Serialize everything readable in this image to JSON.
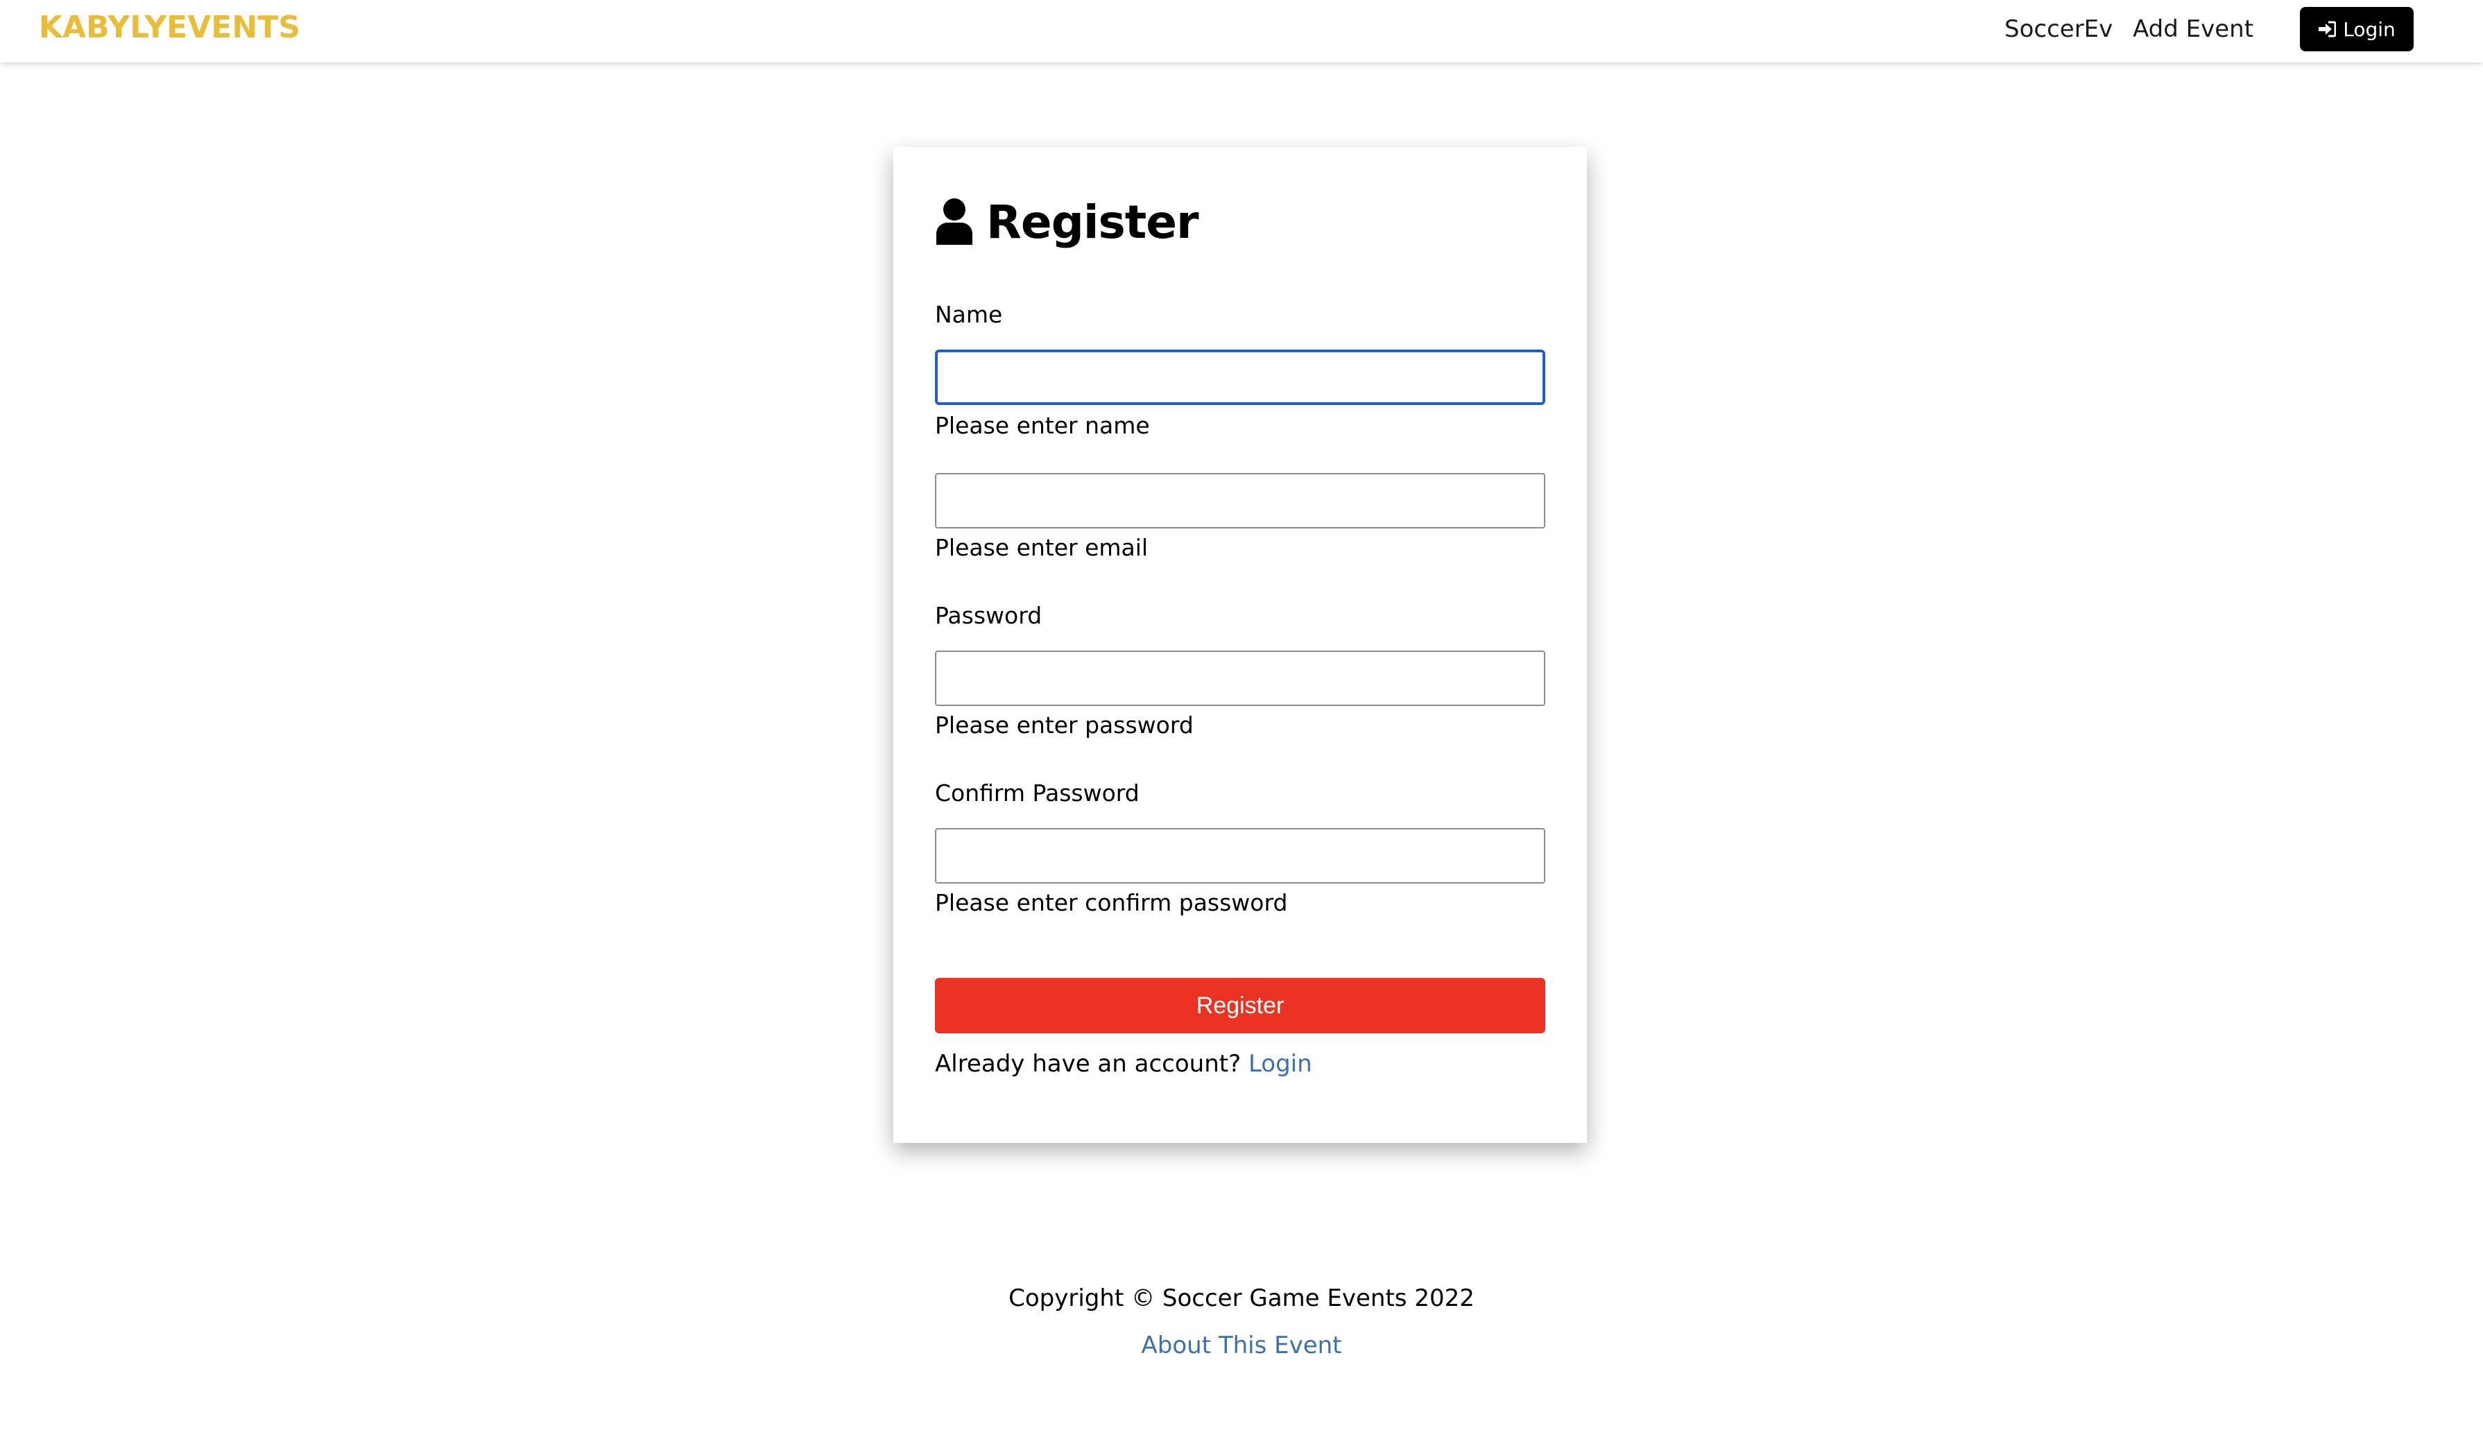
{
  "navbar": {
    "brand": "KABYLYEVENTS",
    "links": [
      {
        "label": "SoccerEv"
      },
      {
        "label": "Add Event"
      }
    ],
    "login_label": "Login",
    "brand_color": "#e8bd3c",
    "login_icon": "sign-in-icon"
  },
  "form": {
    "title": "Register",
    "title_icon": "user-icon",
    "fields": [
      {
        "label": "Name",
        "value": "",
        "hint": "Please enter name"
      },
      {
        "label": "",
        "value": "",
        "hint": "Please enter email"
      },
      {
        "label": "Password",
        "value": "",
        "hint": "Please enter password"
      },
      {
        "label": "Confirm Password",
        "value": "",
        "hint": "Please enter confirm password"
      }
    ],
    "submit_label": "Register",
    "submit_color": "#ea3323",
    "account_prompt": "Already have an account?",
    "login_link": "Login"
  },
  "footer": {
    "copyright": "Copyright © Soccer Game Events 2022",
    "about_link": "About This Event"
  }
}
